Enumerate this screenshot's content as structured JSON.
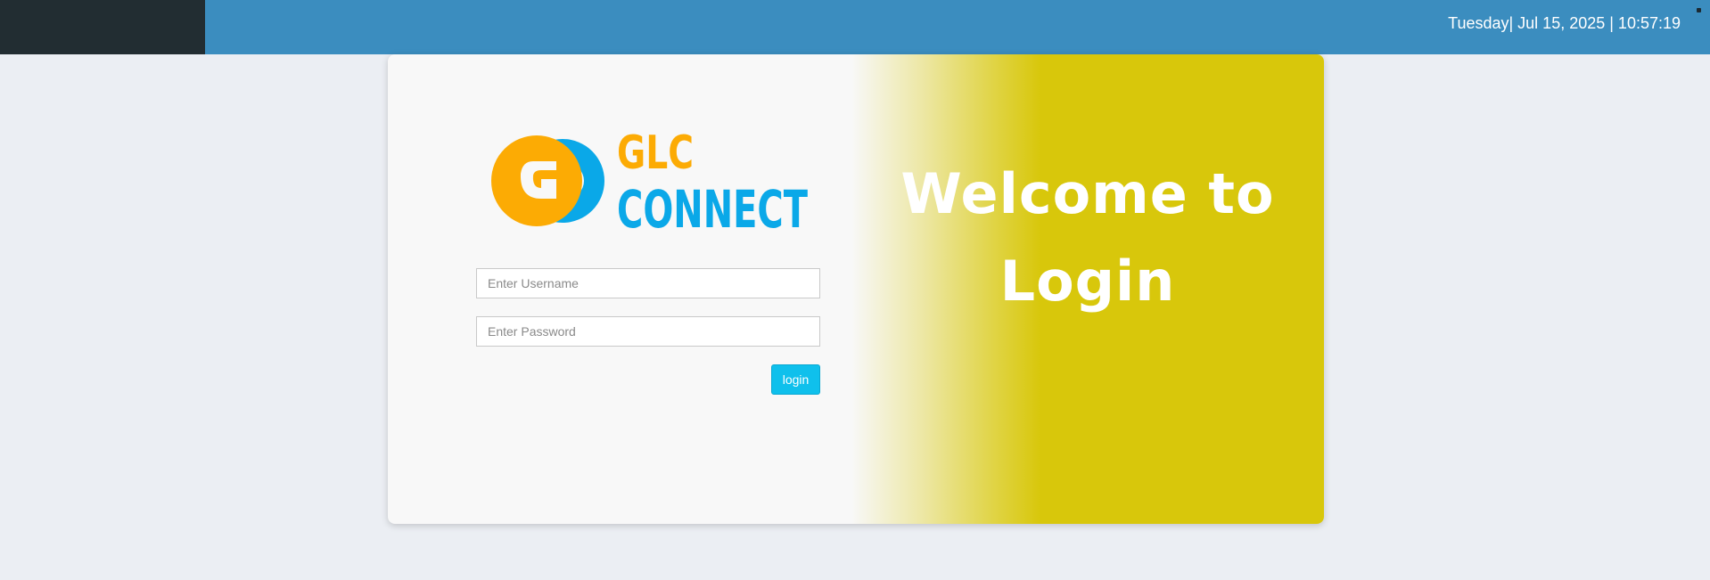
{
  "topbar": {
    "datetime": "Tuesday| Jul 15, 2025 | 10:57:19"
  },
  "logo": {
    "line1": "GLC",
    "line2": "CONNECT",
    "colors": {
      "orange": "#fcab04",
      "blue": "#0aa8e8"
    }
  },
  "form": {
    "username_placeholder": "Enter Username",
    "password_placeholder": "Enter Password",
    "login_label": "login"
  },
  "welcome": {
    "line1": "Welcome to",
    "line2": "Login"
  },
  "colors": {
    "topbar": "#3b8dbf",
    "brand_block": "#222d32",
    "welcome_panel": "#d8c70b",
    "button": "#0fc0ec",
    "page_bg": "#ebeef3"
  }
}
